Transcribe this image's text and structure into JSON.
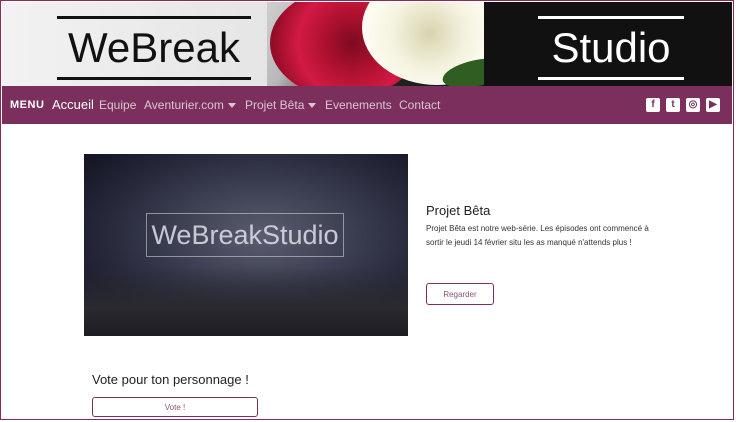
{
  "banner": {
    "logo_left": "WeBreak",
    "logo_right": "Studio"
  },
  "nav": {
    "menu": "MENU",
    "items": [
      {
        "label": "Accueil",
        "active": true,
        "dropdown": false
      },
      {
        "label": "Equipe",
        "active": false,
        "dropdown": false
      },
      {
        "label": "Aventurier.com",
        "active": false,
        "dropdown": true
      },
      {
        "label": "Projet Bêta",
        "active": false,
        "dropdown": true
      },
      {
        "label": "Evenements",
        "active": false,
        "dropdown": false
      },
      {
        "label": "Contact",
        "active": false,
        "dropdown": false
      }
    ],
    "social": [
      {
        "icon": "facebook-icon",
        "glyph": "f"
      },
      {
        "icon": "twitter-icon",
        "glyph": "t"
      },
      {
        "icon": "instagram-icon",
        "glyph": "◎"
      },
      {
        "icon": "youtube-icon",
        "glyph": "▶"
      }
    ]
  },
  "hero": {
    "logo_text": "WeBreakStudio"
  },
  "project": {
    "title": "Projet Bêta",
    "description": "Projet Bêta est notre web-série. Les épisodes ont commencé à sortir le jeudi 14 février situ les as manqué n'attends plus !",
    "button": "Regarder"
  },
  "vote": {
    "title": "Vote pour ton personnage !",
    "button": "Vote !"
  },
  "colors": {
    "nav_bg": "#7b2f5d",
    "accent": "#8a2a55"
  }
}
